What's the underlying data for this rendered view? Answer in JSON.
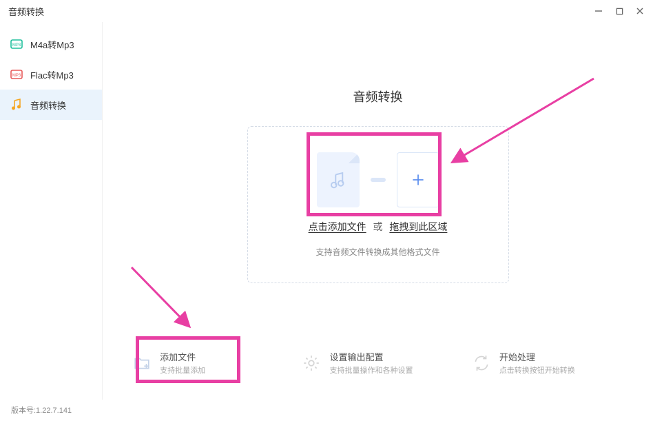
{
  "window": {
    "title": "音频转换"
  },
  "sidebar": {
    "items": [
      {
        "label": "M4a转Mp3"
      },
      {
        "label": "Flac转Mp3"
      },
      {
        "label": "音频转换"
      }
    ]
  },
  "main": {
    "title": "音频转换",
    "dropzone": {
      "click_text": "点击添加文件",
      "or": "或",
      "drag_text": "拖拽到此区域",
      "subtext": "支持音频文件转换成其他格式文件"
    }
  },
  "bottom": {
    "add": {
      "title": "添加文件",
      "sub": "支持批量添加"
    },
    "config": {
      "title": "设置输出配置",
      "sub": "支持批量操作和各种设置"
    },
    "start": {
      "title": "开始处理",
      "sub": "点击转换按钮开始转换"
    }
  },
  "footer": {
    "version_label": "版本号:1.22.7.141"
  }
}
